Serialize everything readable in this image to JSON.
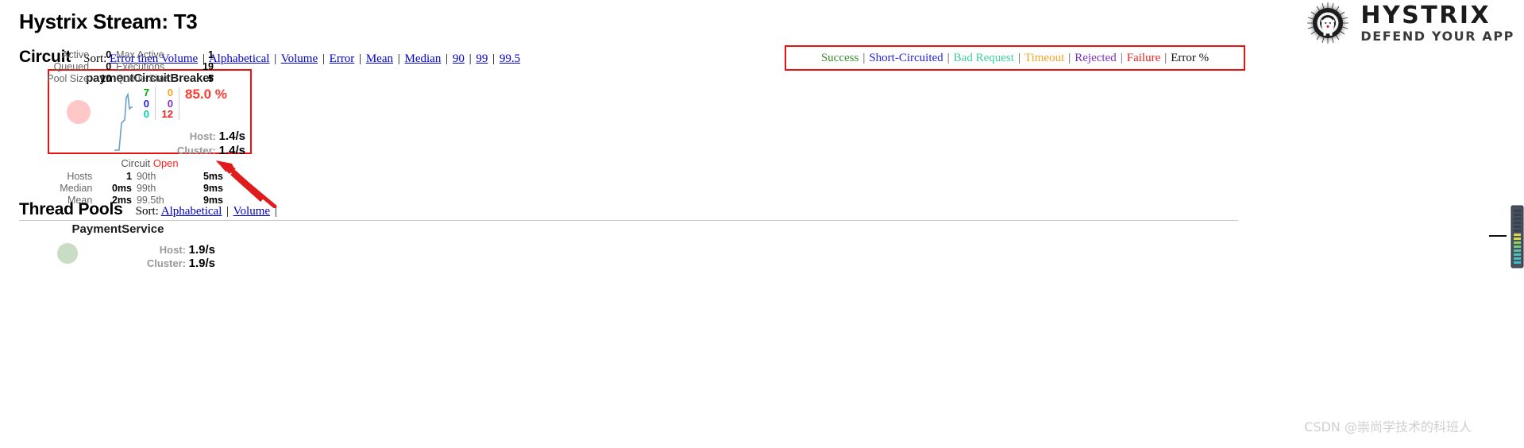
{
  "header": {
    "title": "Hystrix Stream: T3",
    "logo": {
      "title": "HYSTRIX",
      "subtitle": "DEFEND YOUR APP",
      "mark_icon": "hystrix-porcupine-icon"
    }
  },
  "circuit_section": {
    "title": "Circuit",
    "sort_label": "Sort:",
    "sort_links": [
      "Error then Volume",
      "Alphabetical",
      "Volume",
      "Error",
      "Mean",
      "Median",
      "90",
      "99",
      "99.5"
    ],
    "separator": "|"
  },
  "legend": {
    "separator": "|",
    "items": [
      {
        "label": "Success",
        "color": "#3b8b2f"
      },
      {
        "label": "Short-Circuited",
        "color": "#2323dd"
      },
      {
        "label": "Bad Request",
        "color": "#3fd0a0"
      },
      {
        "label": "Timeout",
        "color": "#f5a623"
      },
      {
        "label": "Rejected",
        "color": "#7b2fbe"
      },
      {
        "label": "Failure",
        "color": "#ee2222"
      },
      {
        "label": "Error %",
        "color": "#111111"
      }
    ]
  },
  "circuit_card": {
    "name": "paymentCircuitBreaker",
    "highlighted": true,
    "border_color": "#ee1111",
    "circle_color": "#ffc7c7",
    "counters_left": [
      {
        "name": "success",
        "value": "7",
        "color": "#00aa00"
      },
      {
        "name": "short-circuited",
        "value": "0",
        "color": "#2323dd"
      },
      {
        "name": "bad-request",
        "value": "0",
        "color": "#00d1a0"
      }
    ],
    "counters_right": [
      {
        "name": "timeout",
        "value": "0",
        "color": "#f5a623"
      },
      {
        "name": "rejected",
        "value": "0",
        "color": "#7b2fbe"
      },
      {
        "name": "failure",
        "value": "12",
        "color": "#ee2222"
      }
    ],
    "error_percent": "85.0 %",
    "error_percent_color": "#ff3b30",
    "host_label": "Host:",
    "host_value": "1.4/s",
    "cluster_label": "Cluster:",
    "cluster_value": "1.4/s",
    "status_label": "Circuit",
    "status_value": "Open",
    "status_color": "#ff2222",
    "stats": [
      {
        "name": "Hosts",
        "value": "1",
        "name2": "90th",
        "value2": "5ms"
      },
      {
        "name": "Median",
        "value": "0ms",
        "name2": "99th",
        "value2": "9ms"
      },
      {
        "name": "Mean",
        "value": "2ms",
        "name2": "99.5th",
        "value2": "9ms"
      }
    ]
  },
  "threadpool_section": {
    "title": "Thread Pools",
    "sort_label": "Sort:",
    "sort_links": [
      "Alphabetical",
      "Volume"
    ],
    "separator": "|"
  },
  "pool_card": {
    "name": "PaymentService",
    "circle_color": "#c9dcc4",
    "host_label": "Host:",
    "host_value": "1.9/s",
    "cluster_label": "Cluster:",
    "cluster_value": "1.9/s",
    "stats": [
      {
        "name": "Active",
        "value": "0",
        "name2": "Max Active",
        "value2": "1"
      },
      {
        "name": "Queued",
        "value": "0",
        "name2": "Executions",
        "value2": "19"
      },
      {
        "name": "Pool Size",
        "value": "10",
        "name2": "Queue Size",
        "value2": "5"
      }
    ]
  },
  "annotation": {
    "arrow_color": "#e01b1b",
    "points_at": "Circuit Open"
  },
  "watermark": {
    "text": "CSDN @崇尚学技术的科班人"
  }
}
